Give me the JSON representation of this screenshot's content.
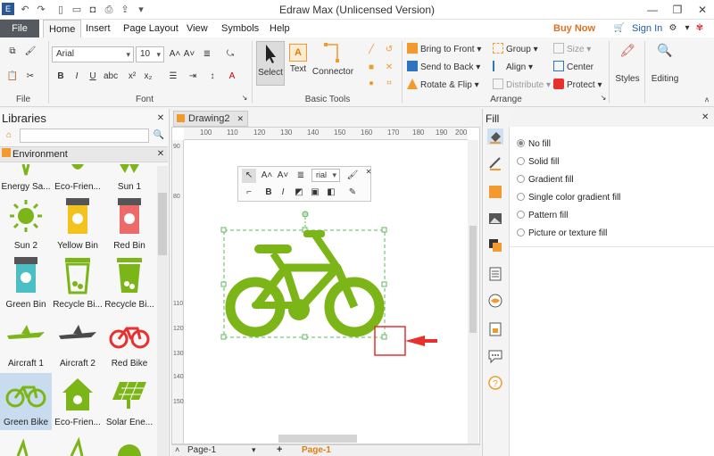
{
  "window": {
    "title": "Edraw Max (Unlicensed Version)",
    "minimize": "—",
    "maximize": "❐",
    "close": "✕"
  },
  "menu": {
    "file": "File",
    "tabs": [
      "Home",
      "Insert",
      "Page Layout",
      "View",
      "Symbols",
      "Help"
    ],
    "buy_now": "Buy Now",
    "sign_in": "Sign In"
  },
  "ribbon": {
    "font_name": "Arial",
    "font_size": "10",
    "select": "Select",
    "text": "Text",
    "connector": "Connector",
    "bring_to_front": "Bring to Front",
    "send_to_back": "Send to Back",
    "rotate_flip": "Rotate & Flip",
    "group": "Group",
    "align": "Align",
    "distribute": "Distribute",
    "size": "Size",
    "center": "Center",
    "protect": "Protect",
    "styles": "Styles",
    "editing": "Editing",
    "groups": {
      "file": "File",
      "font": "Font",
      "basic_tools": "Basic Tools",
      "arrange": "Arrange"
    },
    "bold": "B",
    "italic": "I",
    "underline": "U"
  },
  "libraries": {
    "title": "Libraries",
    "category": "Environment",
    "items": [
      {
        "label": "Energy Sa..."
      },
      {
        "label": "Eco-Frien..."
      },
      {
        "label": "Sun 1"
      },
      {
        "label": "Sun 2"
      },
      {
        "label": "Yellow Bin"
      },
      {
        "label": "Red Bin"
      },
      {
        "label": "Green Bin"
      },
      {
        "label": "Recycle Bi..."
      },
      {
        "label": "Recycle Bi..."
      },
      {
        "label": "Aircraft 1"
      },
      {
        "label": "Aircraft 2"
      },
      {
        "label": "Red Bike"
      },
      {
        "label": "Green Bike"
      },
      {
        "label": "Eco-Frien..."
      },
      {
        "label": "Solar Ene..."
      }
    ]
  },
  "document": {
    "tab": "Drawing2",
    "ruler_h": [
      "100",
      "110",
      "120",
      "130",
      "140",
      "150",
      "160",
      "170",
      "180",
      "190",
      "200"
    ],
    "ruler_v": [
      "90",
      "80",
      "110",
      "120",
      "130",
      "140",
      "150"
    ],
    "page_tab": "Page-1",
    "page_tab_active": "Page-1",
    "mini_font": "rial"
  },
  "fill": {
    "title": "Fill",
    "options": [
      {
        "label": "No fill",
        "selected": true
      },
      {
        "label": "Solid fill",
        "selected": false
      },
      {
        "label": "Gradient fill",
        "selected": false
      },
      {
        "label": "Single color gradient fill",
        "selected": false
      },
      {
        "label": "Pattern fill",
        "selected": false
      },
      {
        "label": "Picture or texture fill",
        "selected": false
      }
    ]
  },
  "colors": {
    "bike": "#7cb518",
    "accent_orange": "#f29a2e",
    "highlight_red": "#e8302f"
  }
}
